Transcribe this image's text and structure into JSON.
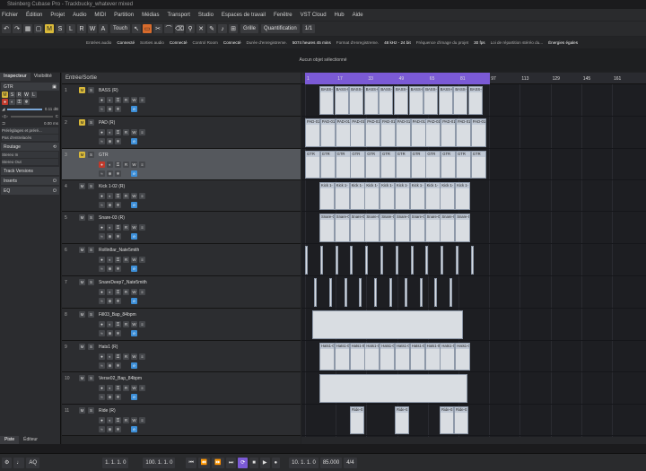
{
  "title": "Steinberg Cubase Pro - Trackbucky_whatever mixed",
  "menu": [
    "Fichier",
    "Édition",
    "Projet",
    "Audio",
    "MIDI",
    "Partition",
    "Médias",
    "Transport",
    "Studio",
    "Espaces de travail",
    "Fenêtre",
    "VST Cloud",
    "Hub",
    "Aide"
  ],
  "toolbar": {
    "touch": "Touch",
    "grid": "Grille",
    "quant": "Quantification",
    "quant_val": "1/1"
  },
  "info": [
    {
      "k": "Entrées audio",
      "v": "Connecté"
    },
    {
      "k": "Sorties audio",
      "v": "Connecté"
    },
    {
      "k": "Control Room",
      "v": "Connecté"
    },
    {
      "k": "Durée d'enregistreme.",
      "v": "5074 heures 45 mins"
    },
    {
      "k": "Format d'enregistreme.",
      "v": "48 kHz - 24 bit"
    },
    {
      "k": "Fréquence d'image du projet",
      "v": "30 fps"
    },
    {
      "k": "Loi de répartition stéréo du...",
      "v": "Énergies égales"
    }
  ],
  "selection": "Aucun objet sélectionné",
  "inspector": {
    "tabs": [
      "Inspecteur",
      "Visibilité"
    ],
    "track_name": "GTR",
    "volume": "0.11 dB",
    "pan": "C",
    "delay": "0.00 ms",
    "prologue": "Prérèglages et préré...",
    "sidechain": "Pas d'entrelacés",
    "sections": {
      "routing": "Routage",
      "in": "Stereo In",
      "out": "Stereo Out",
      "versions": "Track Versions",
      "inserts": "Inserts",
      "eq": "EQ"
    },
    "bottom_tabs": [
      "Piste",
      "Éditeur"
    ]
  },
  "track_list_header": "Entrée/Sortie",
  "tracks": [
    {
      "n": "1",
      "name": "BASS (R)"
    },
    {
      "n": "2",
      "name": "PAD (R)"
    },
    {
      "n": "3",
      "name": "GTR"
    },
    {
      "n": "4",
      "name": "Kick 1-02 (R)"
    },
    {
      "n": "5",
      "name": "Snare-03 (R)"
    },
    {
      "n": "6",
      "name": "Rollin8ar_Nate5mith"
    },
    {
      "n": "7",
      "name": "SnareDeep7_Nate5mith"
    },
    {
      "n": "8",
      "name": "Fill03_Bap_84bpm"
    },
    {
      "n": "9",
      "name": "Hats1 (R)"
    },
    {
      "n": "10",
      "name": "Verse02_Bap_84bpm"
    },
    {
      "n": "11",
      "name": "Ride (R)"
    }
  ],
  "clip_labels": {
    "bass": "BASS-0",
    "pad": "PAD-01",
    "gtr": "GTR",
    "kick": "Kick 1-",
    "snare": "Snare-0",
    "hats": "Hats1-0",
    "ride": "Ride-01"
  },
  "ruler": [
    "1",
    "17",
    "33",
    "49",
    "65",
    "81",
    "97",
    "113",
    "129",
    "145",
    "161"
  ],
  "transport": {
    "pos": "1. 1. 1. 0",
    "tempo": "100. 1. 1. 0",
    "right_pos": "10. 1. 1. 0",
    "bpm": "85.000",
    "sig": "4/4",
    "aq": "AQ"
  }
}
